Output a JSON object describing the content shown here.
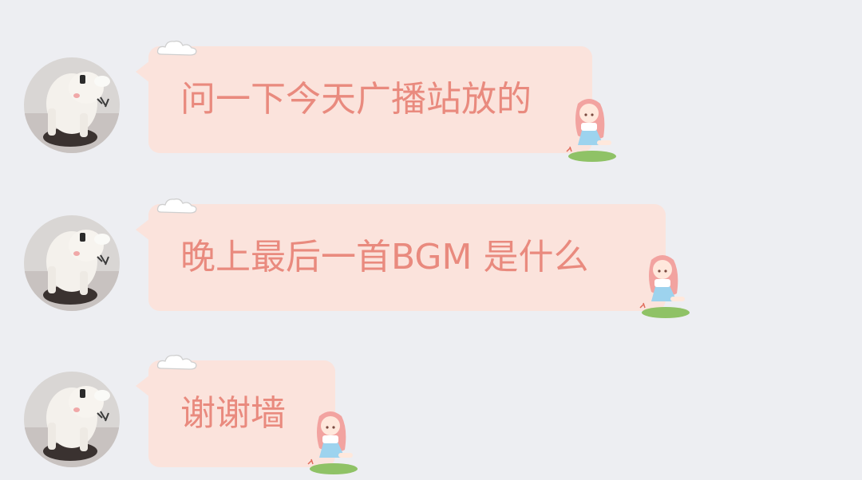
{
  "colors": {
    "background": "#edeef2",
    "bubble": "#fbe3dc",
    "text": "#e98a7e"
  },
  "messages": [
    {
      "text": "问一下今天广播站放的",
      "avatar_icon": "sheep-avatar-icon",
      "sticker_icon": "girl-sticker-icon",
      "decoration_icon": "cloud-icon"
    },
    {
      "text": "晚上最后一首BGM 是什么",
      "avatar_icon": "sheep-avatar-icon",
      "sticker_icon": "girl-sticker-icon",
      "decoration_icon": "cloud-icon"
    },
    {
      "text": "谢谢墙",
      "avatar_icon": "sheep-avatar-icon",
      "sticker_icon": "girl-sticker-icon",
      "decoration_icon": "cloud-icon"
    }
  ]
}
